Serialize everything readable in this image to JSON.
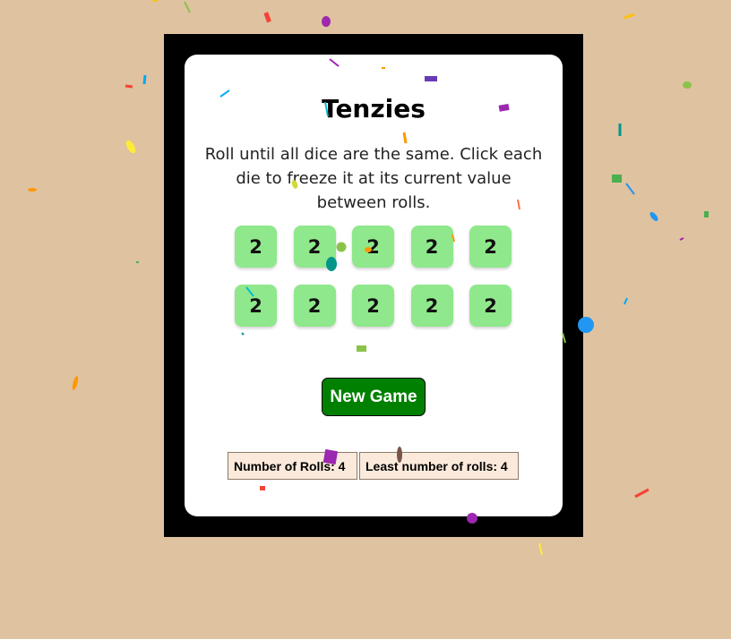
{
  "game": {
    "title": "Tenzies",
    "instructions": "Roll until all dice are the same. Click each die to freeze it at its current value between rolls.",
    "dice": [
      "2",
      "2",
      "2",
      "2",
      "2",
      "2",
      "2",
      "2",
      "2",
      "2"
    ],
    "dice_color": "#8fe88b",
    "new_game_label": "New Game",
    "button_color": "#008000"
  },
  "stats": {
    "rolls_label": "Number of Rolls: 4",
    "least_rolls_label": "Least number of rolls: 4"
  },
  "theme": {
    "background": "#dfc29f",
    "frame": "#000000",
    "card": "#ffffff"
  }
}
